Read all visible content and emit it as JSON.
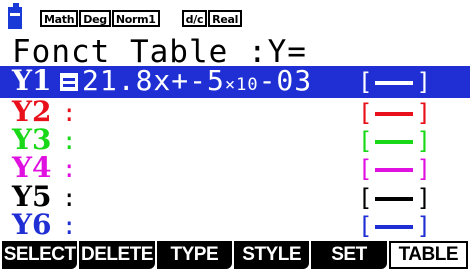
{
  "status_bar": {
    "battery_icon": "battery-icon",
    "badges": [
      "Math",
      "Deg",
      "Norm1",
      "d/c",
      "Real"
    ]
  },
  "title": "Fonct Table :Y=",
  "functions": [
    {
      "label": "Y1",
      "equals": "=",
      "expr_main": "21.8x+-5",
      "expr_small": "×10",
      "expr_tail": "-03",
      "style_open": "[",
      "style_close": "]",
      "color": "#ffffff",
      "selected": true
    },
    {
      "label": "Y2",
      "colon": ":",
      "style_open": "[",
      "style_close": "]",
      "color": "#e8101a"
    },
    {
      "label": "Y3",
      "colon": ":",
      "style_open": "[",
      "style_close": "]",
      "color": "#18d818"
    },
    {
      "label": "Y4",
      "colon": ":",
      "style_open": "[",
      "style_close": "]",
      "color": "#e010e0"
    },
    {
      "label": "Y5",
      "colon": ":",
      "style_open": "[",
      "style_close": "]",
      "color": "#000000"
    },
    {
      "label": "Y6",
      "colon": ":",
      "style_open": "[",
      "style_close": "]",
      "color": "#1f2fd4"
    }
  ],
  "fkeys": [
    {
      "label": "SELECT",
      "type": "menu"
    },
    {
      "label": "DELETE",
      "type": "menu"
    },
    {
      "label": "TYPE",
      "type": "menu"
    },
    {
      "label": "STYLE",
      "type": "menu"
    },
    {
      "label": "SET",
      "type": "menu"
    },
    {
      "label": "TABLE",
      "type": "tab"
    }
  ],
  "colors": {
    "highlight": "#1f2fd4",
    "y2": "#e8101a",
    "y3": "#18d818",
    "y4": "#e010e0",
    "y5": "#000000",
    "y6": "#1f2fd4"
  }
}
